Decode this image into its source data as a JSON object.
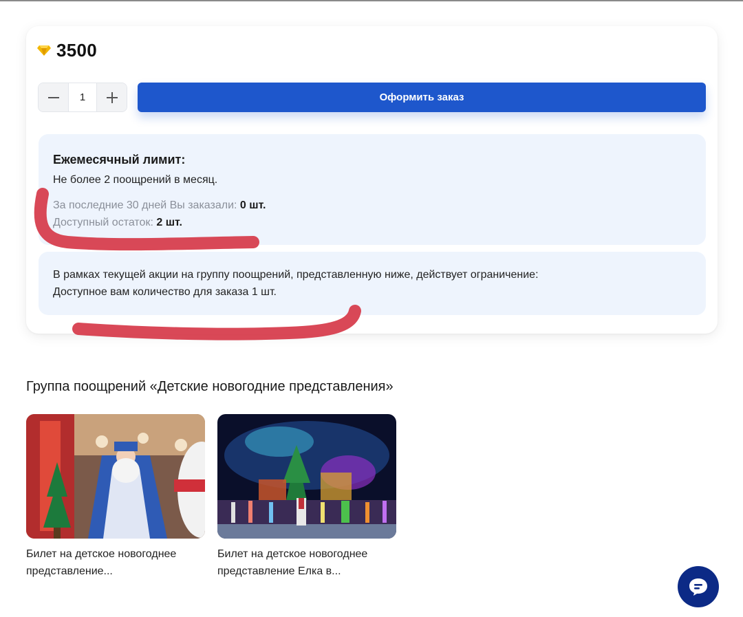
{
  "colors": {
    "primary": "#1e57cc",
    "info_bg": "#eef4fd",
    "annotation_red": "#d63a4a",
    "chat_button": "#0c2a86",
    "gem": "#f2b705"
  },
  "price": {
    "icon": "diamond-icon",
    "value": "3500"
  },
  "stepper": {
    "minus": "−",
    "quantity": "1",
    "plus": "+"
  },
  "order_button": {
    "label": "Оформить заказ"
  },
  "monthly_limit": {
    "title": "Ежемесячный лимит:",
    "text": "Не более 2 поощрений в месяц.",
    "ordered_label": "За последние 30 дней Вы заказали: ",
    "ordered_value": "0 шт.",
    "remaining_label": "Доступный остаток: ",
    "remaining_value": "2 шт."
  },
  "promo_limit": {
    "line1": "В рамках текущей акции на группу поощрений, представленную ниже, действует ограничение:",
    "line2": "Доступное вам количество для заказа 1 шт."
  },
  "group": {
    "title": "Группа поощрений «Детские новогодние представления»",
    "products": [
      {
        "image": "santa-performance-photo",
        "name_line1": "Билет на детское новогоднее",
        "name_line2": "представление..."
      },
      {
        "image": "stage-show-photo",
        "name_line1": "Билет на детское новогоднее",
        "name_line2": "представление Елка в..."
      }
    ]
  },
  "chat": {
    "icon": "chat-bubble-icon"
  }
}
